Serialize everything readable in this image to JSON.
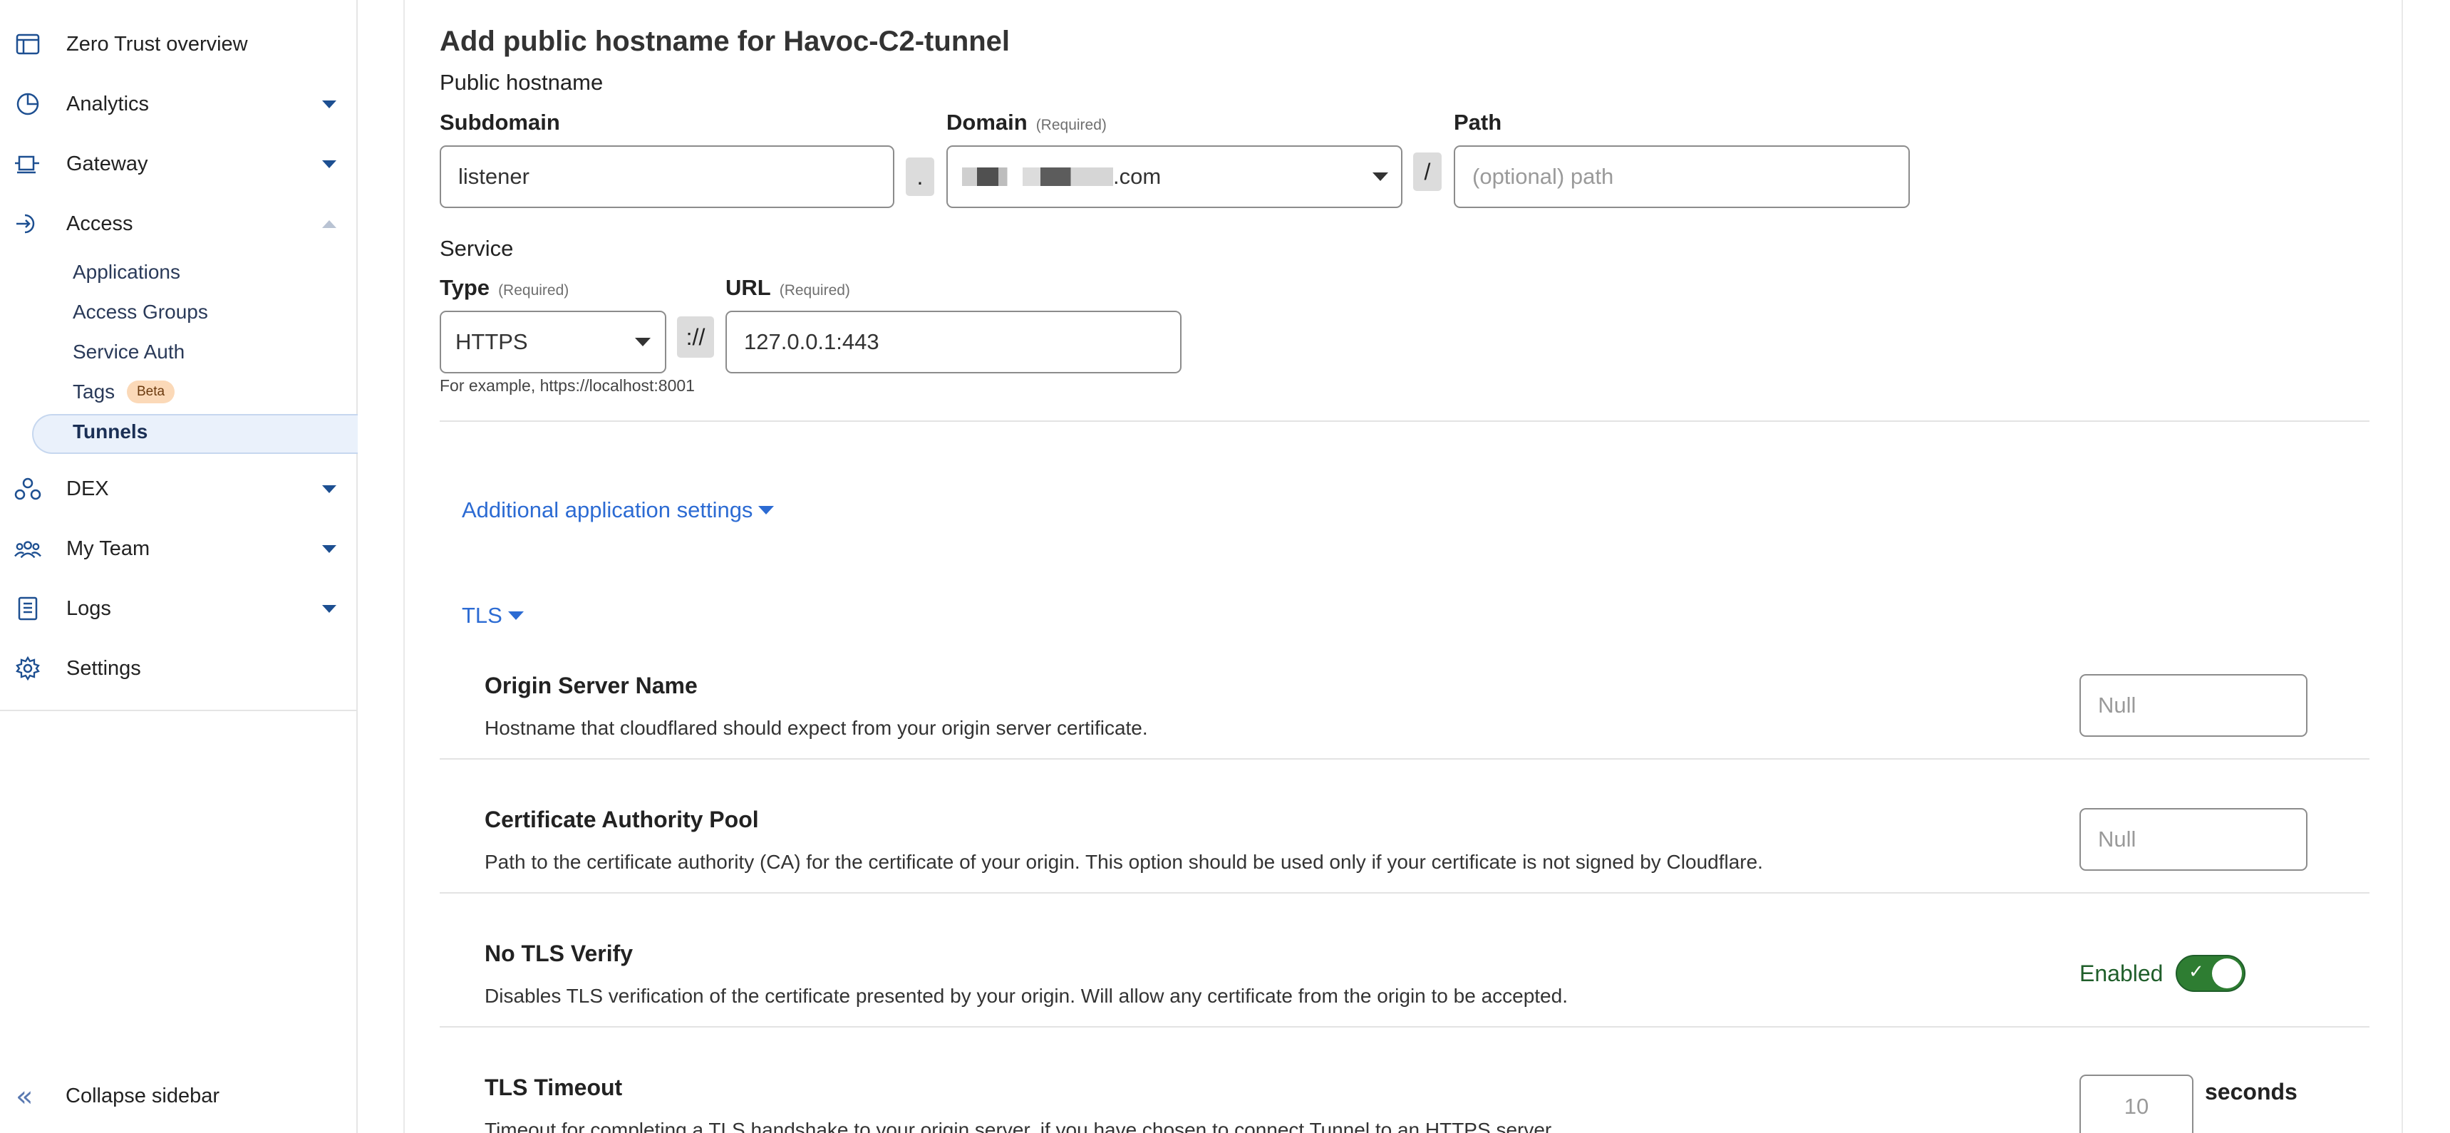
{
  "sidebar": {
    "items": [
      {
        "label": "Zero Trust overview",
        "icon": "browser-window-icon"
      },
      {
        "label": "Analytics",
        "icon": "pie-chart-icon"
      },
      {
        "label": "Gateway",
        "icon": "gateway-icon"
      },
      {
        "label": "Access",
        "icon": "access-icon"
      },
      {
        "label": "DEX",
        "icon": "dex-icon"
      },
      {
        "label": "My Team",
        "icon": "team-icon"
      },
      {
        "label": "Logs",
        "icon": "logs-icon"
      },
      {
        "label": "Settings",
        "icon": "gear-icon"
      }
    ],
    "access_sub": [
      "Applications",
      "Access Groups",
      "Service Auth",
      "Tags",
      "Tunnels"
    ],
    "tags_badge": "Beta",
    "collapse_label": "Collapse sidebar"
  },
  "main": {
    "title": "Add public hostname for Havoc-C2-tunnel",
    "public_hostname": {
      "section": "Public hostname",
      "subdomain_label": "Subdomain",
      "subdomain_value": "listener",
      "dot": ".",
      "domain_label": "Domain",
      "required": "(Required)",
      "domain_value": ".com",
      "slash": "/",
      "path_label": "Path",
      "path_placeholder": "(optional) path"
    },
    "service": {
      "section": "Service",
      "type_label": "Type",
      "type_value": "HTTPS",
      "scheme_sep": "://",
      "url_label": "URL",
      "url_value": "127.0.0.1:443",
      "hint": "For example, https://localhost:8001"
    },
    "additional_settings": "Additional application settings",
    "tls": {
      "label": "TLS",
      "origin_server_name": {
        "title": "Origin Server Name",
        "desc": "Hostname that cloudflared should expect from your origin server certificate.",
        "placeholder": "Null"
      },
      "ca_pool": {
        "title": "Certificate Authority Pool",
        "desc": "Path to the certificate authority (CA) for the certificate of your origin. This option should be used only if your certificate is not signed by Cloudflare.",
        "placeholder": "Null"
      },
      "no_tls_verify": {
        "title": "No TLS Verify",
        "desc": "Disables TLS verification of the certificate presented by your origin. Will allow any certificate from the origin to be accepted.",
        "status": "Enabled",
        "enabled": true
      },
      "tls_timeout": {
        "title": "TLS Timeout",
        "desc": "Timeout for completing a TLS handshake to your origin server, if you have chosen to connect Tunnel to an HTTPS server.",
        "placeholder": "10",
        "unit": "seconds"
      }
    }
  },
  "colors": {
    "accent": "#2c6bd3",
    "toggle_on": "#2e7d32",
    "active_nav": "#eaf1fb"
  }
}
